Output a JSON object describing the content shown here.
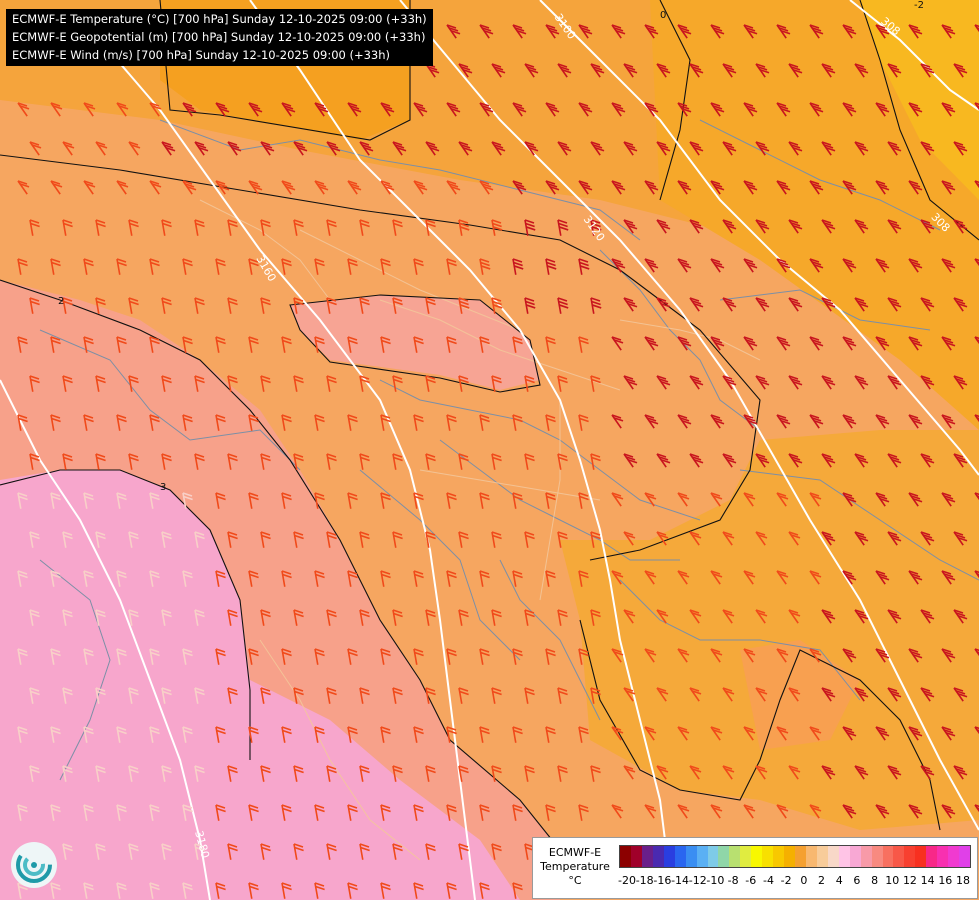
{
  "header": {
    "line1": "ECMWF-E Temperature (°C) [700 hPa] Sunday 12-10-2025 09:00 (+33h)",
    "line2": "ECMWF-E Geopotential (m) [700 hPa] Sunday 12-10-2025 09:00 (+33h)",
    "line3": "ECMWF-E Wind (m/s) [700 hPa] Sunday 12-10-2025 09:00 (+33h)"
  },
  "contour_labels": {
    "gp_3100": "3100",
    "gp_3120": "3120",
    "gp_3160": "3160",
    "gp_3180": "3180",
    "gp_3080a": "308",
    "gp_3080b": "308",
    "t_0": "0",
    "t_2": "2",
    "t_3": "3",
    "t_m2": "-2"
  },
  "legend": {
    "title_line1": "ECMWF-E",
    "title_line2": "Temperature",
    "title_line3": "°C",
    "ticks": [
      "-20",
      "-18",
      "-16",
      "-14",
      "-12",
      "-10",
      "-8",
      "-6",
      "-4",
      "-2",
      "0",
      "2",
      "4",
      "6",
      "8",
      "10",
      "12",
      "14",
      "16",
      "18"
    ],
    "colors": [
      "#8c0000",
      "#a0002a",
      "#6a1f8a",
      "#4a2ab0",
      "#2a3ee0",
      "#2a66f0",
      "#3a8ef2",
      "#5ab0f4",
      "#7ecbe8",
      "#8fd6a8",
      "#b8e070",
      "#e0ec40",
      "#f8f800",
      "#f8e000",
      "#f8c800",
      "#f5b000",
      "#f5a030",
      "#f8b870",
      "#f8cc9a",
      "#f8d8c8",
      "#ffc4e6",
      "#f8a8d4",
      "#f89aa8",
      "#f88a80",
      "#f87060",
      "#f85848",
      "#f84030",
      "#f83020",
      "#f82888",
      "#f830b0",
      "#f03ad0",
      "#e040e8"
    ]
  },
  "colors": {
    "warm_band": "#f5a34a",
    "cool_band": "#f7b06a",
    "cold_core": "#f5b030",
    "warmer": "#f6a270",
    "pink_zone": "#f7a090",
    "magenta_zone": "#f7a4cc",
    "barb_dark": "#c8151e",
    "barb_mid": "#f04a1a",
    "barb_light": "#f27030",
    "barb_pale": "#f8d0c8"
  },
  "logo": {
    "icon": "ecmwf-swirl-icon"
  }
}
